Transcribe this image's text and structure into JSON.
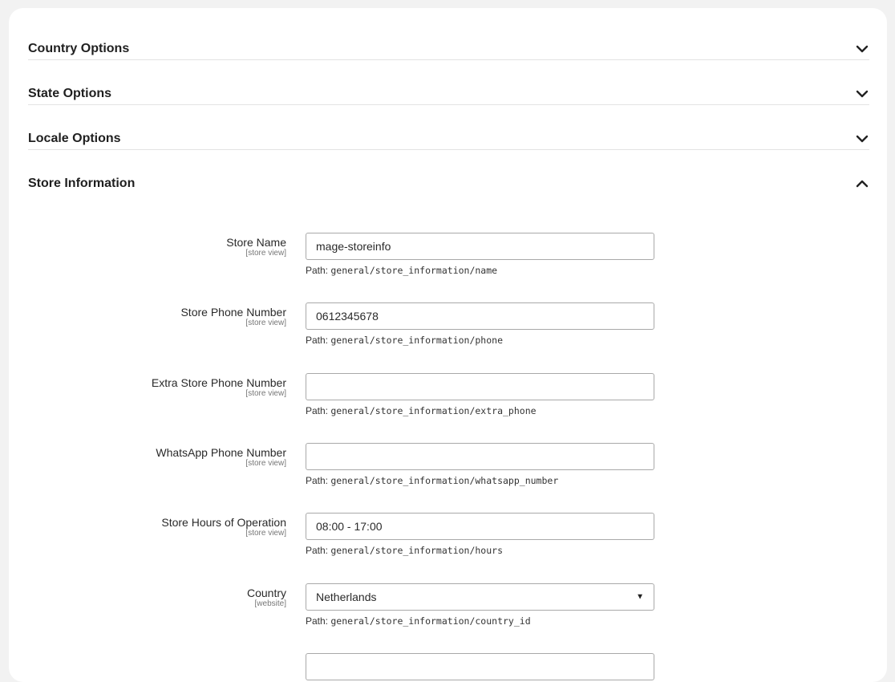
{
  "sections": [
    {
      "title": "Country Options",
      "icon": "chevron-down-icon"
    },
    {
      "title": "State Options",
      "icon": "chevron-down-icon"
    },
    {
      "title": "Locale Options",
      "icon": "chevron-down-icon"
    },
    {
      "title": "Store Information",
      "icon": "chevron-up-icon"
    }
  ],
  "store_information": {
    "path_prefix": "Path:",
    "fields": [
      {
        "label": "Store Name",
        "scope": "[store view]",
        "value": "mage-storeinfo",
        "path": "general/store_information/name"
      },
      {
        "label": "Store Phone Number",
        "scope": "[store view]",
        "value": "0612345678",
        "path": "general/store_information/phone"
      },
      {
        "label": "Extra Store Phone Number",
        "scope": "[store view]",
        "value": "",
        "path": "general/store_information/extra_phone"
      },
      {
        "label": "WhatsApp Phone Number",
        "scope": "[store view]",
        "value": "",
        "path": "general/store_information/whatsapp_number"
      },
      {
        "label": "Store Hours of Operation",
        "scope": "[store view]",
        "value": "08:00 - 17:00",
        "path": "general/store_information/hours"
      },
      {
        "label": "Country",
        "scope": "[website]",
        "value": "Netherlands",
        "path": "general/store_information/country_id"
      }
    ]
  }
}
